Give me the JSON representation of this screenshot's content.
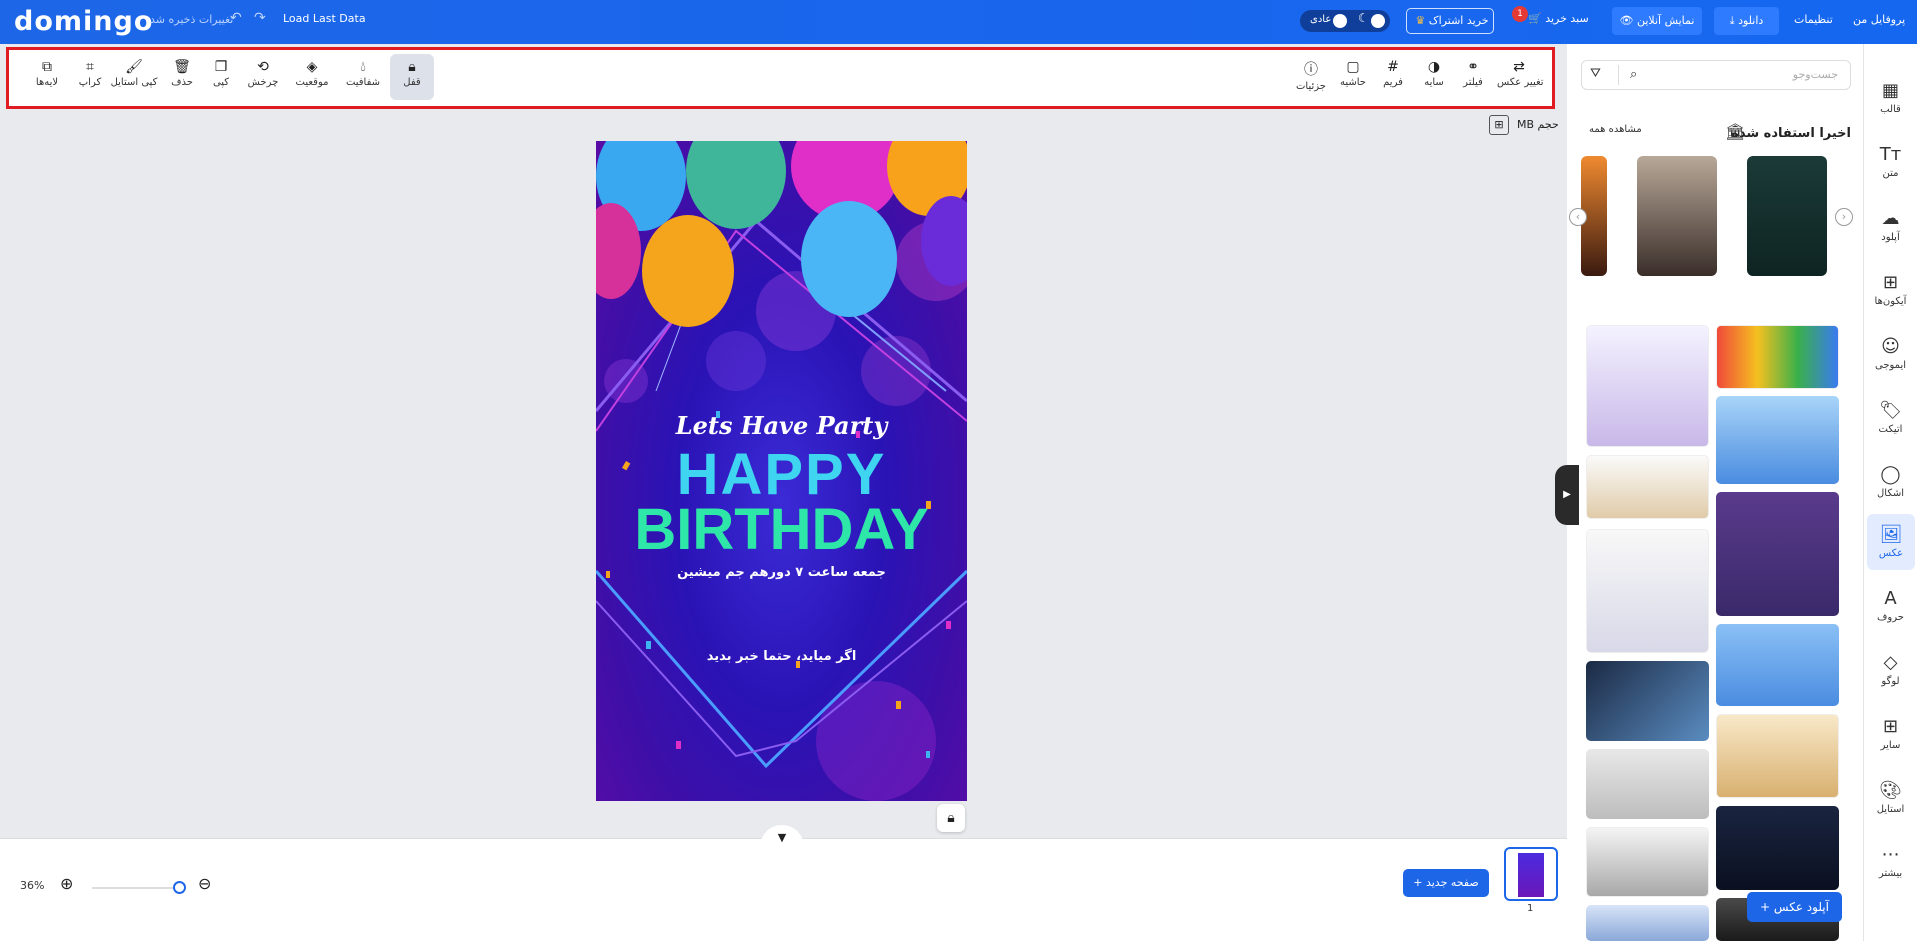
{
  "topbar": {
    "logo": "domingo",
    "saved_text": "تغییرات ذخیره شد",
    "load_last": "Load Last Data",
    "mode_label": "عادی",
    "subscribe": "خرید اشتراک",
    "cart": "سبد خرید",
    "cart_count": "1",
    "preview": "نمایش آنلاین",
    "download": "دانلود",
    "settings": "تنظیمات",
    "profile": "پروفایل من"
  },
  "rail": {
    "items": [
      {
        "label": "قالب",
        "icon": "template-icon"
      },
      {
        "label": "متن",
        "icon": "text-icon"
      },
      {
        "label": "آپلود",
        "icon": "upload-icon"
      },
      {
        "label": "آیکون‌ها",
        "icon": "icons-icon"
      },
      {
        "label": "ایموجی",
        "icon": "emoji-icon"
      },
      {
        "label": "اتیکت",
        "icon": "tag-icon"
      },
      {
        "label": "اشکال",
        "icon": "shapes-icon"
      },
      {
        "label": "عکس",
        "icon": "photo-icon"
      },
      {
        "label": "حروف",
        "icon": "letters-icon"
      },
      {
        "label": "لوگو",
        "icon": "logo-icon"
      },
      {
        "label": "سایر",
        "icon": "other-icon"
      },
      {
        "label": "استایل",
        "icon": "palette-icon"
      },
      {
        "label": "بیشتر",
        "icon": "more-icon"
      }
    ]
  },
  "panel": {
    "search_placeholder": "جست‌وجو",
    "recent_title": "اخیرا استفاده شده",
    "see_all": "مشاهده همه",
    "upload_photo": "آپلود عکس"
  },
  "toolbar": {
    "right_tools": [
      {
        "label": "تغییر عکس",
        "icon": "swap-icon"
      },
      {
        "label": "فیلتر",
        "icon": "filter-icon"
      },
      {
        "label": "سایه",
        "icon": "shadow-icon"
      },
      {
        "label": "فریم",
        "icon": "frame-icon"
      },
      {
        "label": "حاشیه",
        "icon": "border-icon"
      },
      {
        "label": "جزئیات",
        "icon": "info-icon"
      }
    ],
    "left_tools": [
      {
        "label": "قفل",
        "icon": "lock-icon"
      },
      {
        "label": "شفافیت",
        "icon": "opacity-icon"
      },
      {
        "label": "موقعیت",
        "icon": "layers-icon"
      },
      {
        "label": "چرخش",
        "icon": "rotate-icon"
      },
      {
        "label": "کپی",
        "icon": "copy-icon"
      },
      {
        "label": "حذف",
        "icon": "trash-icon"
      },
      {
        "label": "کپی استایل",
        "icon": "brush-icon"
      },
      {
        "label": "کراپ",
        "icon": "crop-icon"
      },
      {
        "label": "لایه‌ها",
        "icon": "stack-icon"
      }
    ]
  },
  "canvas": {
    "size_label": "حجم MB",
    "poster": {
      "party": "Lets Have Party",
      "happy": "HAPPY",
      "birthday": "BIRTHDAY",
      "line1": "جمعه ساعت ۷ دورهم جم میشین",
      "line2": "اگر میاید، حتما خبر بدید"
    }
  },
  "bottom": {
    "zoom": "36%",
    "new_page": "صفحه جدید",
    "page_num": "1"
  },
  "colors": {
    "accent": "#1d66e8",
    "highlight_border": "#e11b22"
  }
}
